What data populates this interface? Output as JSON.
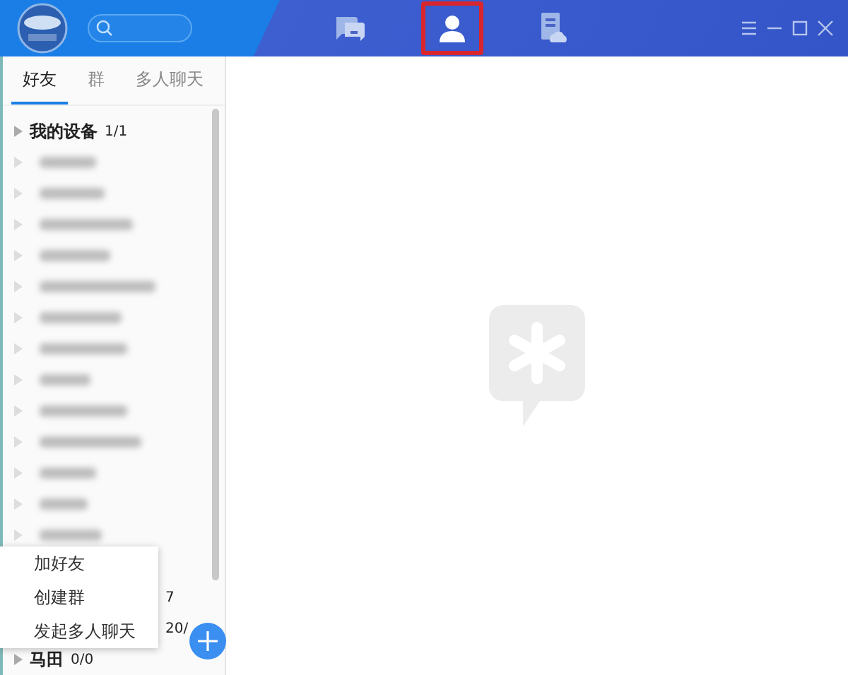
{
  "header": {
    "nav": [
      {
        "kind": "chat",
        "selected": false
      },
      {
        "kind": "contacts",
        "selected": true
      },
      {
        "kind": "files",
        "selected": false
      }
    ]
  },
  "tabs": [
    {
      "label": "好友",
      "selected": true
    },
    {
      "label": "群",
      "selected": false
    },
    {
      "label": "多人聊天",
      "selected": false
    }
  ],
  "groups": [
    {
      "kind": "full",
      "name": "我的设备",
      "count": "1/1"
    },
    {
      "kind": "covered",
      "count": "7"
    },
    {
      "kind": "covered",
      "count": "20/"
    },
    {
      "kind": "full",
      "name": "马田",
      "count": "0/0"
    }
  ],
  "menu": {
    "items": [
      {
        "label": "加好友"
      },
      {
        "label": "创建群"
      },
      {
        "label": "发起多人聊天"
      }
    ]
  }
}
